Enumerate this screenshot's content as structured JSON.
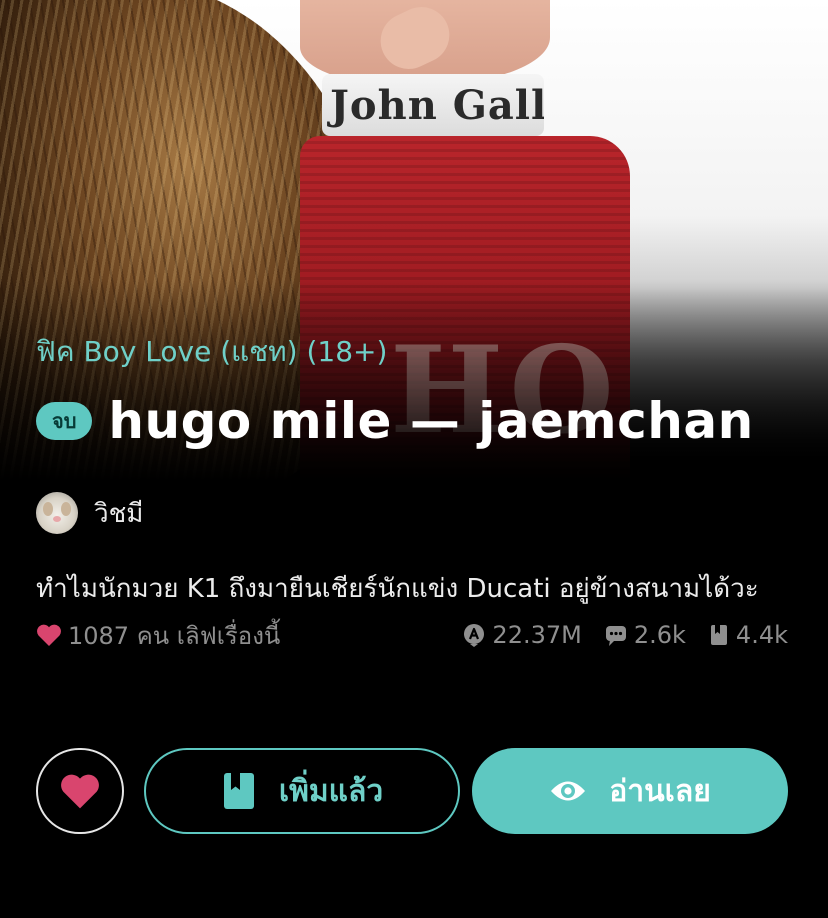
{
  "cover": {
    "waistband_text": "John Galli"
  },
  "story": {
    "category": "ฟิค Boy Love (แชท) (18+)",
    "status_badge": "จบ",
    "title": "hugo mile — jaemchan",
    "author": "วิชมี",
    "synopsis": "ทำไมนักมวย K1 ถึงมายืนเชียร์นักแข่ง Ducati อยู่ข้างสนามได้วะ"
  },
  "stats": {
    "love_count_text": "1087 คน เลิฟเรื่องนี้",
    "views": "22.37M",
    "comments": "2.6k",
    "bookmarks": "4.4k"
  },
  "actions": {
    "added_label": "เพิ่มแล้ว",
    "read_label": "อ่านเลย"
  },
  "icons": {
    "heart": "heart-icon",
    "views": "views-icon",
    "comments": "comment-icon",
    "bookmarks": "bookmark-icon",
    "added": "book-icon",
    "read": "eye-icon"
  },
  "colors": {
    "accent": "#5ec8c1",
    "accent_text": "#6fd0c8",
    "heart": "#d9456e",
    "muted": "#8f8f8f",
    "background": "#000000"
  }
}
